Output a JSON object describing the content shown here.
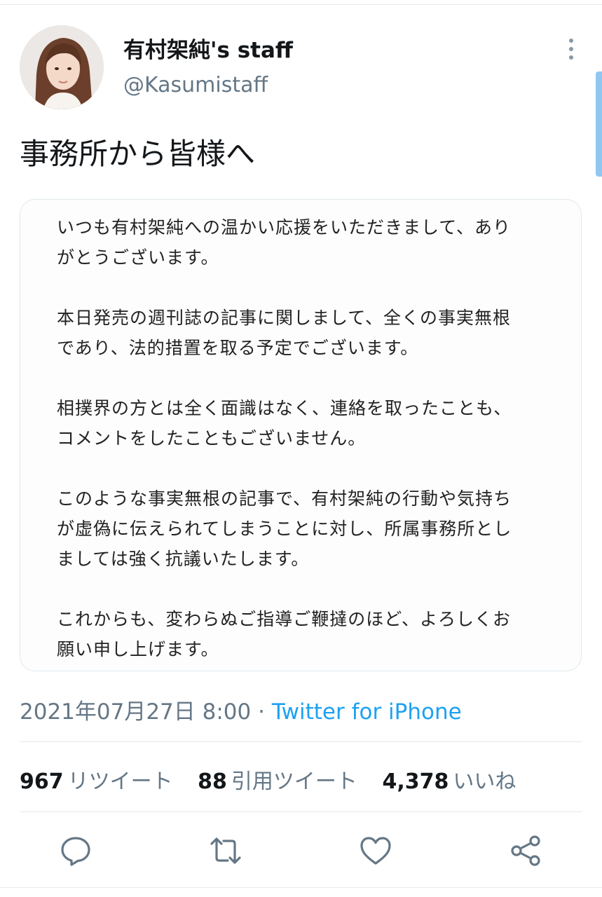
{
  "account": {
    "display_name": "有村架純's staff",
    "handle": "@Kasumistaff"
  },
  "tweet": {
    "text": "事務所から皆様へ",
    "statement_paragraphs": [
      "いつも有村架純への温かい応援をいただきまして、あり\nがとうございます。",
      "本日発売の週刊誌の記事に関しまして、全くの事実無根\nであり、法的措置を取る予定でございます。",
      "相撲界の方とは全く面識はなく、連絡を取ったことも、\nコメントをしたこともございません。",
      "このような事実無根の記事で、有村架純の行動や気持ち\nが虚偽に伝えられてしまうことに対し、所属事務所とし\nましては強く抗議いたします。",
      "これからも、変わらぬご指導ご鞭撻のほど、よろしくお\n願い申し上げます。"
    ],
    "timestamp": "2021年07月27日 8:00",
    "separator": " · ",
    "source": "Twitter for iPhone"
  },
  "stats": {
    "retweets": {
      "count": "967",
      "label": "リツイート"
    },
    "quotes": {
      "count": "88",
      "label": "引用ツイート"
    },
    "likes": {
      "count": "4,378",
      "label": "いいね"
    }
  },
  "icons": {
    "more": "more-vertical-icon",
    "reply": "reply-icon",
    "retweet": "retweet-icon",
    "like": "heart-icon",
    "share": "share-icon"
  },
  "colors": {
    "text": "#14171a",
    "secondary": "#657786",
    "accent": "#1da1f2",
    "divider": "#e1e8ed"
  }
}
